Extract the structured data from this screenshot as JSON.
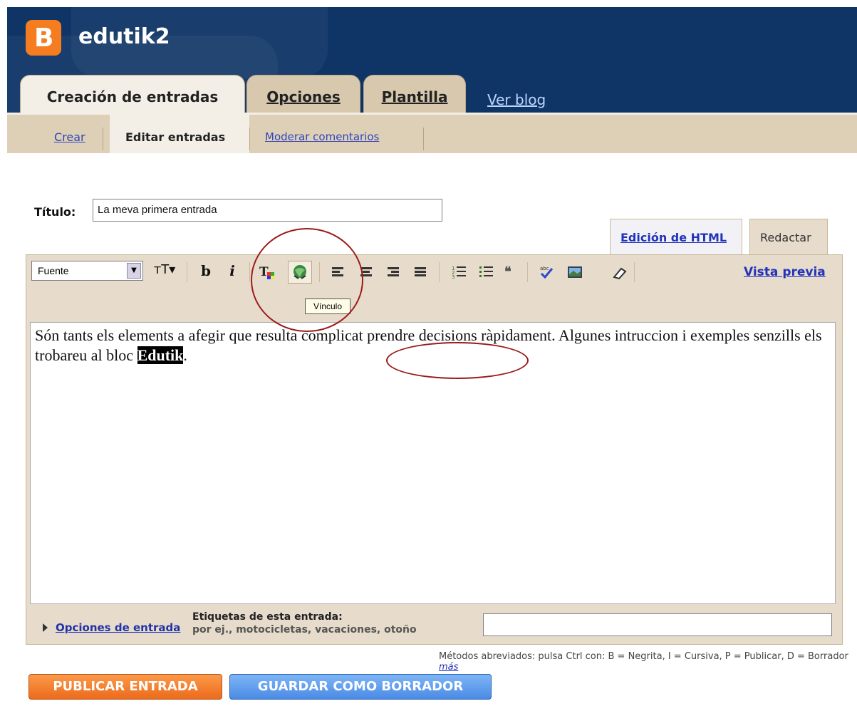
{
  "header": {
    "logo_letter": "B",
    "blog_name": "edutik2",
    "tabs": [
      {
        "label": "Creación de entradas"
      },
      {
        "label": "Opciones"
      },
      {
        "label": "Plantilla"
      }
    ],
    "view_blog": "Ver blog"
  },
  "subnav": {
    "items": [
      {
        "label": "Crear"
      },
      {
        "label": "Editar entradas"
      },
      {
        "label": "Moderar comentarios"
      }
    ]
  },
  "post": {
    "title_label": "Título:",
    "title_value": "La meva primera entrada",
    "mode_tabs": {
      "html": "Edición de HTML",
      "compose": "Redactar"
    },
    "body_text_1": "Són tants els elements a afegir que resulta complicat prendre decisions ràpidament. Algunes intruccion i exemples senzills els trobareu al bloc ",
    "body_selected": "Edutik",
    "body_text_2": "."
  },
  "toolbar": {
    "font_select": "Fuente",
    "font_size_icon": "text-size-icon",
    "bold": "b",
    "italic": "i",
    "tooltip": "Vínculo",
    "preview": "Vista previa"
  },
  "post_options": {
    "options_link": "Opciones de entrada",
    "labels_title": "Etiquetas de esta entrada:",
    "labels_hint": "por ej., motocicletas, vacaciones, otoño",
    "labels_value": ""
  },
  "shortcuts": {
    "text": "Métodos abreviados: pulsa Ctrl con: B = Negrita, I = Cursiva, P = Publicar, D = Borrador",
    "more_link": "más"
  },
  "actions": {
    "publish": "PUBLICAR ENTRADA",
    "save_draft": "GUARDAR COMO BORRADOR"
  },
  "colors": {
    "header_bg": "#0f3566",
    "logo": "#f57d20",
    "tab_bg": "#d8c9ae",
    "publish_button": "#ec6b1c",
    "draft_button": "#4b8be6",
    "annotation_circle": "#9a1b1b"
  }
}
